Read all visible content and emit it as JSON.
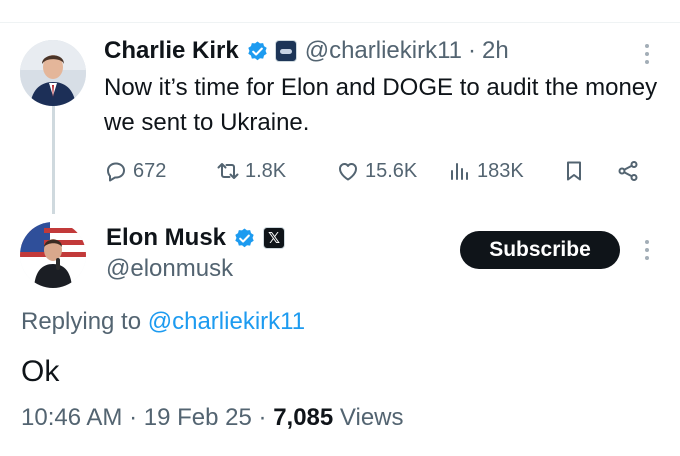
{
  "parent_tweet": {
    "author_name": "Charlie Kirk",
    "handle": "@charliekirk11",
    "separator": "·",
    "time_ago": "2h",
    "text": "Now it’s time for Elon and DOGE to audit the money we sent to Ukraine.",
    "stats": {
      "replies": "672",
      "reposts": "1.8K",
      "likes": "15.6K",
      "views": "183K"
    },
    "icons": [
      "verified-badge-icon",
      "affiliate-badge-icon",
      "more-icon",
      "reply-icon",
      "repost-icon",
      "like-icon",
      "views-icon",
      "bookmark-icon",
      "share-icon"
    ]
  },
  "reply_tweet": {
    "author_name": "Elon Musk",
    "handle": "@elonmusk",
    "affiliate_badge": "𝕏",
    "subscribe_label": "Subscribe",
    "replying_prefix": "Replying to",
    "replying_to": "@charliekirk11",
    "text": "Ok",
    "time": "10:46 AM",
    "separator": "·",
    "date": "19 Feb 25",
    "separator2": "·",
    "views_count": "7,085",
    "views_label": "Views",
    "icons": [
      "verified-badge-icon",
      "x-logo-icon",
      "more-icon"
    ]
  },
  "colors": {
    "text": "#0f1419",
    "muted": "#536471",
    "link": "#1d9bf0",
    "verified": "#1d9bf0",
    "thread_line": "#cfd9de",
    "subscribe_bg": "#0f1419"
  }
}
